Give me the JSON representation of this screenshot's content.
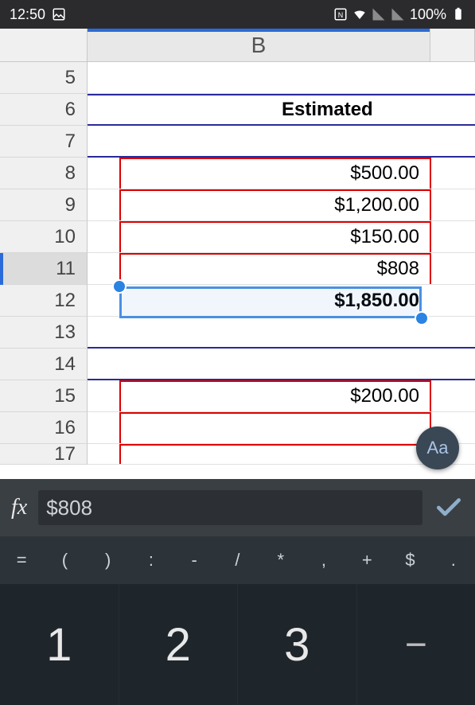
{
  "status": {
    "time": "12:50",
    "battery": "100%"
  },
  "sheet": {
    "column_label": "B",
    "rows": [
      {
        "num": "5",
        "value": ""
      },
      {
        "num": "6",
        "value": "Estimated",
        "header": true
      },
      {
        "num": "7",
        "value": ""
      },
      {
        "num": "8",
        "value": "$500.00"
      },
      {
        "num": "9",
        "value": "$1,200.00"
      },
      {
        "num": "10",
        "value": "$150.00"
      },
      {
        "num": "11",
        "value": "$808",
        "active": true
      },
      {
        "num": "12",
        "value": "$1,850.00",
        "bold": true
      },
      {
        "num": "13",
        "value": ""
      },
      {
        "num": "14",
        "value": ""
      },
      {
        "num": "15",
        "value": "$200.00"
      },
      {
        "num": "16",
        "value": ""
      },
      {
        "num": "17",
        "value": ""
      }
    ]
  },
  "formula": {
    "value": "$808"
  },
  "fab": {
    "label": "Aa"
  },
  "symbols": [
    "=",
    "(",
    ")",
    ":",
    "-",
    "/",
    "*",
    ",",
    "+",
    "$",
    "."
  ],
  "numpad": [
    "1",
    "2",
    "3",
    "−"
  ]
}
